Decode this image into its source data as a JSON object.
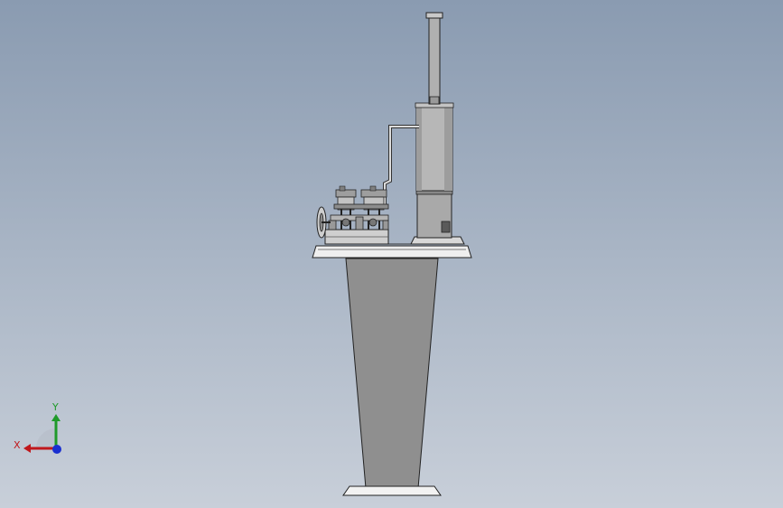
{
  "viewport": {
    "background_top": "#8a9bb1",
    "background_bottom": "#c8cfd9"
  },
  "model": {
    "name_icon": "steam-engine-model",
    "parts": [
      "pedestal",
      "base-plate",
      "boiler",
      "chimney",
      "steam-pipe",
      "twin-cylinder-engine",
      "flywheel"
    ]
  },
  "triad": {
    "x_label": "X",
    "y_label": "Y",
    "x_color": "#c0181c",
    "y_color": "#1f9a2a",
    "z_color": "#1a2fd0"
  }
}
